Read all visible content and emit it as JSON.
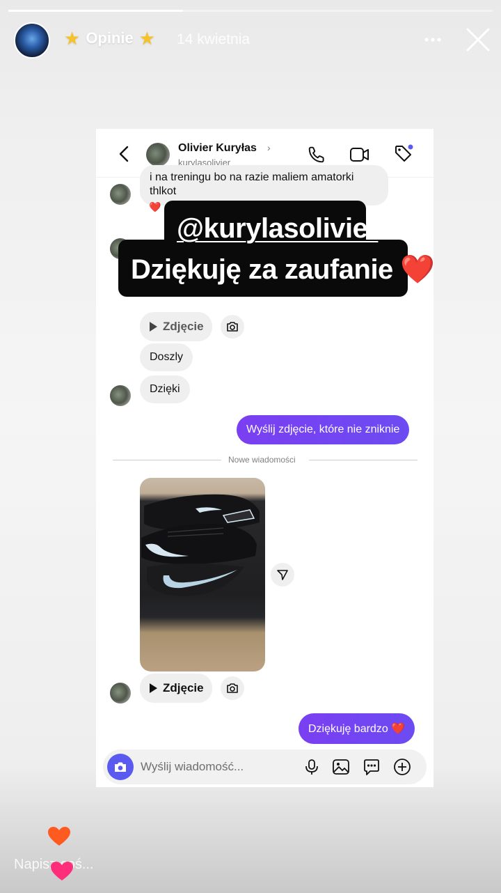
{
  "story": {
    "title": "Opinie",
    "star_icon": "star-icon",
    "date": "14 kwietnia",
    "progress_fraction": 0.36,
    "more_icon": "more-icon",
    "close_icon": "close-icon",
    "reply_placeholder": "Napisz coś..."
  },
  "caption": {
    "line1": "@kurylasolivier",
    "line2": "Dziękuję za zaufanie ❤️"
  },
  "dm": {
    "contact_name": "Olivier Kuryłas",
    "contact_handle": "kurylasolivier",
    "chevron": "›",
    "messages": {
      "cut_top": "i na treningu bo na razie maliem amatorki",
      "cut_line2": "thlkot",
      "reaction": "❤️",
      "photo_label_1": "Zdjęcie",
      "doszly": "Doszly",
      "dzieki": "Dzięki",
      "sent_1": "Wyślij zdjęcie, które nie zniknie",
      "new_divider": "Nowe wiadomości",
      "photo_label_2": "Zdjęcie",
      "sent_2": "Dziękuję bardzo ❤️"
    },
    "composer_placeholder": "Wyślij wiadomość..."
  },
  "colors": {
    "outgoing_bubble": "#7b3ef0",
    "incoming_bubble": "#efefef",
    "composer_camera": "#5a5af0",
    "caption_box": "#0a0a0a",
    "heart_orange": "#ff5a1f",
    "heart_pink": "#ff2d7a"
  }
}
